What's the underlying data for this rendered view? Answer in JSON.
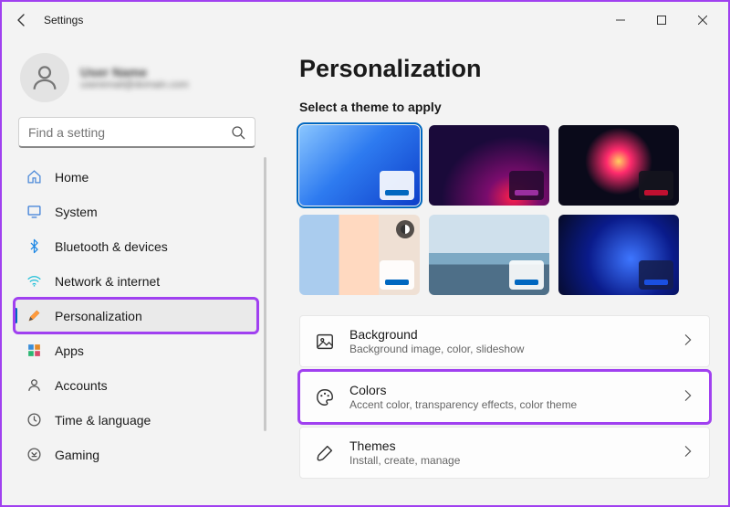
{
  "window": {
    "title": "Settings"
  },
  "profile": {
    "name": "User Name",
    "email": "useremail@domain.com"
  },
  "search": {
    "placeholder": "Find a setting"
  },
  "sidebar": {
    "items": [
      {
        "icon": "home",
        "label": "Home"
      },
      {
        "icon": "system",
        "label": "System"
      },
      {
        "icon": "bluetooth",
        "label": "Bluetooth & devices"
      },
      {
        "icon": "wifi",
        "label": "Network & internet"
      },
      {
        "icon": "personalization",
        "label": "Personalization",
        "selected": true,
        "highlight": true
      },
      {
        "icon": "apps",
        "label": "Apps"
      },
      {
        "icon": "accounts",
        "label": "Accounts"
      },
      {
        "icon": "time",
        "label": "Time & language"
      },
      {
        "icon": "gaming",
        "label": "Gaming"
      }
    ]
  },
  "page": {
    "title": "Personalization",
    "theme_section_label": "Select a theme to apply",
    "themes": [
      {
        "bg": "linear-gradient(135deg,#4aa8ff,#0a4bd4 55%,#2c6df0)",
        "accent": "#0067c0",
        "chipBg": "rgba(255,255,255,0.92)",
        "selected": true
      },
      {
        "bg": "radial-gradient(circle at 70% 80%, #ff1f4a 0%, #7a0c6d 25%, #1a0a3a 65%)",
        "accent": "#9a2fa0",
        "chipBg": "rgba(40,10,50,0.9)"
      },
      {
        "bg": "radial-gradient(circle at 50% 45%, #ff2b6d 0%, #ffaa33 18%, #0a0a1a 42%)",
        "accent": "#c01030",
        "chipBg": "rgba(20,20,30,0.9)"
      },
      {
        "bg": "linear-gradient(90deg,#aaccee 0 33%,#ffe7d6 33% 66%,#efe0d4 66% 100%)",
        "accent": "#0067c0",
        "chipBg": "rgba(255,255,255,0.92)",
        "badge": true
      },
      {
        "bg": "linear-gradient(180deg,#c7d9e6 0 48%, #7da9c4 48% 62%, #567894 62% 100%)",
        "accent": "#0067c0",
        "chipBg": "rgba(255,255,255,0.92)"
      },
      {
        "bg": "radial-gradient(circle at 60% 55%,#2e66ff 0%,#0a1b6b 55%,#060a25 100%)",
        "accent": "#1a4fe0",
        "chipBg": "rgba(20,30,80,0.9)"
      }
    ],
    "rows": [
      {
        "icon": "image",
        "title": "Background",
        "sub": "Background image, color, slideshow"
      },
      {
        "icon": "palette",
        "title": "Colors",
        "sub": "Accent color, transparency effects, color theme",
        "highlight": true
      },
      {
        "icon": "brush",
        "title": "Themes",
        "sub": "Install, create, manage"
      }
    ]
  }
}
